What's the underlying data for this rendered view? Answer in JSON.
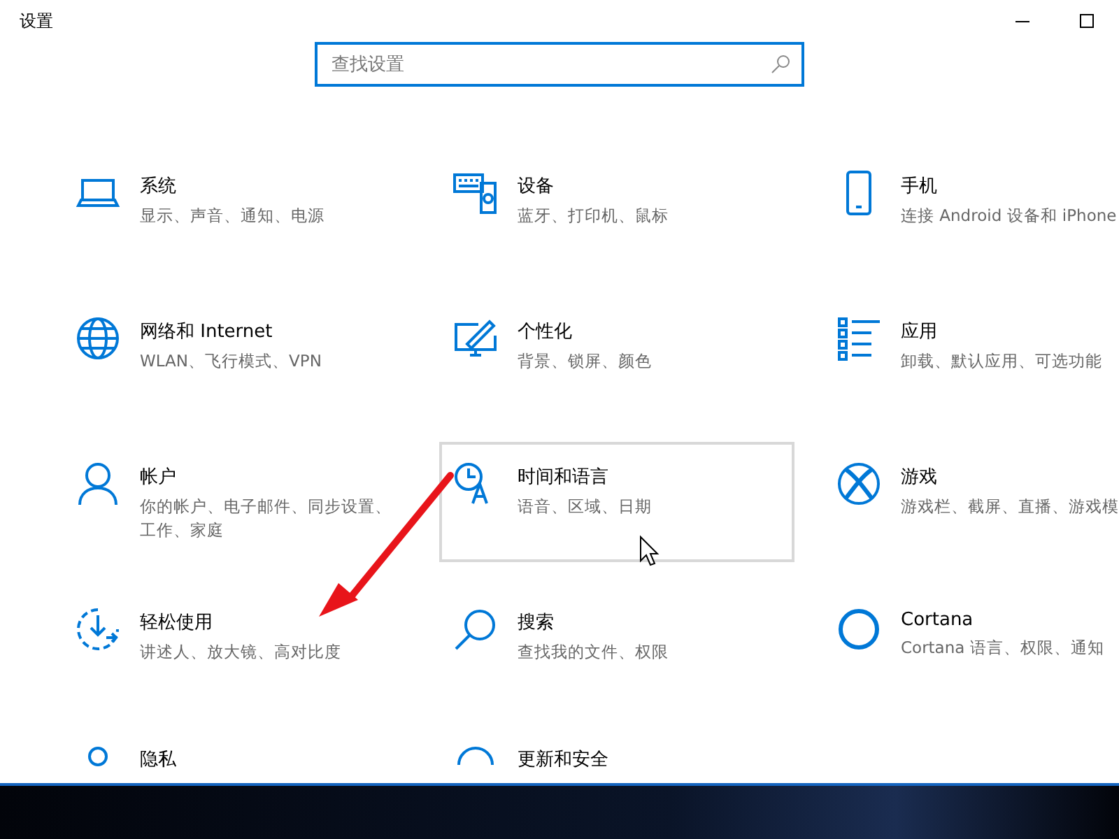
{
  "window": {
    "title": "设置"
  },
  "search": {
    "placeholder": "查找设置"
  },
  "tiles": [
    {
      "kind": "laptop",
      "title": "系统",
      "subtitle": "显示、声音、通知、电源",
      "hovered": false
    },
    {
      "kind": "keyboard",
      "title": "设备",
      "subtitle": "蓝牙、打印机、鼠标",
      "hovered": false
    },
    {
      "kind": "phone",
      "title": "手机",
      "subtitle": "连接 Android 设备和 iPhone",
      "hovered": false
    },
    {
      "kind": "globe",
      "title": "网络和 Internet",
      "subtitle": "WLAN、飞行模式、VPN",
      "hovered": false
    },
    {
      "kind": "paint",
      "title": "个性化",
      "subtitle": "背景、锁屏、颜色",
      "hovered": false
    },
    {
      "kind": "apps",
      "title": "应用",
      "subtitle": "卸载、默认应用、可选功能",
      "hovered": false
    },
    {
      "kind": "person",
      "title": "帐户",
      "subtitle": "你的帐户、电子邮件、同步设置、工作、家庭",
      "hovered": false
    },
    {
      "kind": "clock",
      "title": "时间和语言",
      "subtitle": "语音、区域、日期",
      "hovered": true
    },
    {
      "kind": "xbox",
      "title": "游戏",
      "subtitle": "游戏栏、截屏、直播、游戏模",
      "hovered": false
    },
    {
      "kind": "ease",
      "title": "轻松使用",
      "subtitle": "讲述人、放大镜、高对比度",
      "hovered": false
    },
    {
      "kind": "search",
      "title": "搜索",
      "subtitle": "查找我的文件、权限",
      "hovered": false
    },
    {
      "kind": "ring",
      "title": "Cortana",
      "subtitle": "Cortana 语言、权限、通知",
      "hovered": false
    },
    {
      "kind": "lock",
      "title": "隐私",
      "hovered": false
    },
    {
      "kind": "update",
      "title": "更新和安全",
      "hovered": false
    }
  ]
}
